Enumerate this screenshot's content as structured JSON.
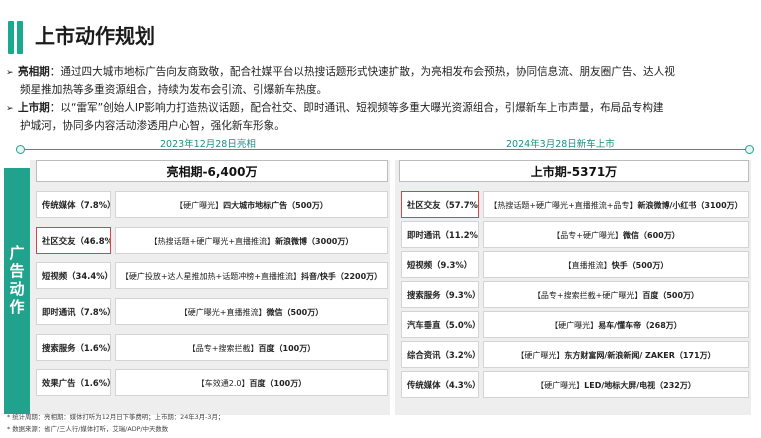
{
  "title": "上市动作规划",
  "bullets": [
    {
      "label": "亮相期",
      "lines": [
        "：通过四大城市地标广告向友商致敬，配合社媒平台以热搜话题形式快速扩散，为亮相发布会预热，协同信息流、朋友圈广告、达人视",
        "频星推加热等多重资源组合，持续为发布会引流、引爆新车热度。"
      ]
    },
    {
      "label": "上市期",
      "lines": [
        "：以“雷军”创始人IP影响力打造热议话题，配合社交、即时通讯、短视频等多重大曝光资源组合，引爆新车上市声量，布局品专构建",
        "护城河，协同多内容活动渗透用户心智，强化新车形象。"
      ]
    }
  ],
  "side_label": [
    "广",
    "告",
    "动",
    "作"
  ],
  "timeline": {
    "left_date": "2023年12月28日亮相",
    "right_date": "2024年3月28日新车上市"
  },
  "left_phase": {
    "title": "亮相期-6,400万",
    "rows": [
      {
        "category": "传统媒体（7.8%）",
        "desc_plain": "【硬广曝光】",
        "desc_bold": "四大城市地标广告（500万）",
        "highlight": false
      },
      {
        "category": "社区交友（46.8%）",
        "desc_plain": "【热搜话题+硬广曝光+直播推流】",
        "desc_bold": "新浪微博（3000万）",
        "highlight": true
      },
      {
        "category": "短视频（34.4%）",
        "desc_plain": "【硬广投放+达人星推加热+话题冲榜+直播推流】",
        "desc_bold": "抖音/快手（2200万）",
        "highlight": false
      },
      {
        "category": "即时通讯（7.8%）",
        "desc_plain": "【硬广曝光+直播推流】",
        "desc_bold": "微信（500万）",
        "highlight": false
      },
      {
        "category": "搜索服务（1.6%）",
        "desc_plain": "【品专+搜索拦截】",
        "desc_bold": "百度（100万）",
        "highlight": false
      },
      {
        "category": "效果广告（1.6%）",
        "desc_plain": "【车效通2.0】",
        "desc_bold": "百度（100万）",
        "highlight": false
      }
    ]
  },
  "right_phase": {
    "title": "上市期-5371万",
    "rows": [
      {
        "category": "社区交友（57.7%）",
        "desc_plain": "【热搜话题+硬广曝光+直播推流+品专】",
        "desc_bold": "新浪微博/小红书（3100万）",
        "highlight": true
      },
      {
        "category": "即时通讯（11.2%）",
        "desc_plain": "【品专+硬广曝光】",
        "desc_bold": "微信（600万）",
        "highlight": false
      },
      {
        "category": "短视频（9.3%）",
        "desc_plain": "【直播推流】",
        "desc_bold": "快手（500万）",
        "highlight": false
      },
      {
        "category": "搜索服务（9.3%）",
        "desc_plain": "【品专+搜索拦截+硬广曝光】",
        "desc_bold": "百度（500万）",
        "highlight": false
      },
      {
        "category": "汽车垂直（5.0%）",
        "desc_plain": "【硬广曝光】",
        "desc_bold": "易车/懂车帝（268万）",
        "highlight": false
      },
      {
        "category": "综合资讯（3.2%）",
        "desc_plain": "【硬广曝光】",
        "desc_bold": "东方财富网/新浪新闻/ ZAKER（171万）",
        "highlight": false
      },
      {
        "category": "传统媒体（4.3%）",
        "desc_plain": "【硬广曝光】",
        "desc_bold": "LED/地标大屏/电视（232万）",
        "highlight": false
      }
    ]
  },
  "footnotes": [
    "* 统计周期：亮相期：媒体打听为12月日下筝费明；上市期：24年3月-3月；",
    "* 数据来源：省广/三人行/媒体打听，艾瑞/ADP/中天数数"
  ],
  "colors": {
    "accent": "#1aa88e",
    "side_tab": "#20a28c",
    "highlight_border": "#d64541"
  }
}
